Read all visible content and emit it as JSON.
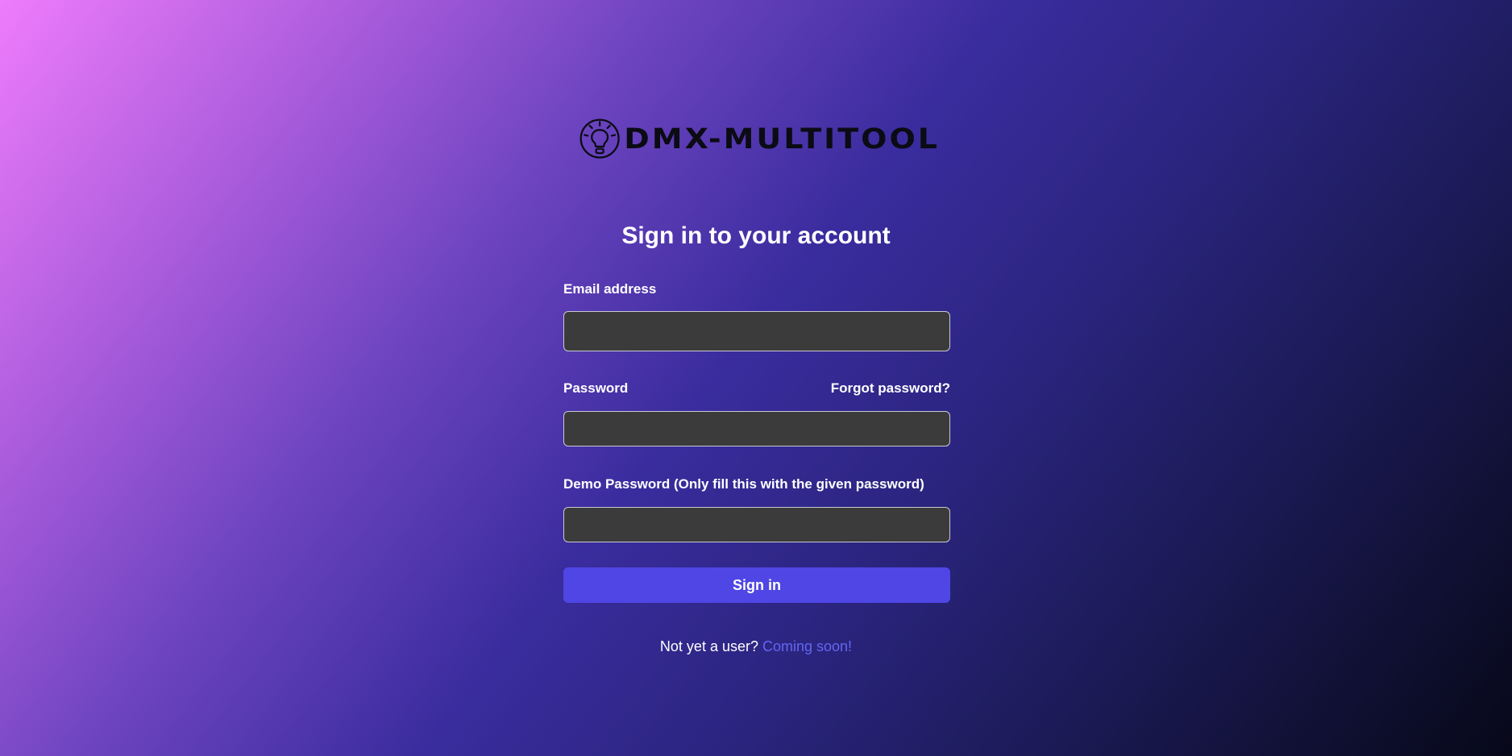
{
  "brand": {
    "name": "DMX-MULTITOOL",
    "logo_icon": "lightbulb-icon"
  },
  "title": "Sign in to your account",
  "form": {
    "email_label": "Email address",
    "email_value": "",
    "password_label": "Password",
    "forgot_password": "Forgot password?",
    "password_value": "",
    "demo_password_label": "Demo Password (Only fill this with the given password)",
    "demo_password_value": "",
    "submit_label": "Sign in"
  },
  "footer": {
    "prompt": "Not yet a user?",
    "link": "Coming soon!"
  },
  "colors": {
    "accent": "#4f46e5",
    "link": "#6366f1",
    "input_bg": "#3b3b3b"
  }
}
